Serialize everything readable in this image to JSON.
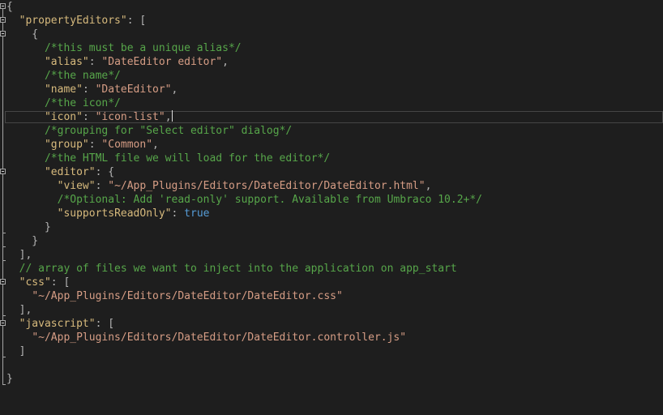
{
  "lines": [
    [
      {
        "t": "p",
        "v": "{"
      }
    ],
    [
      {
        "t": "p",
        "v": "  "
      },
      {
        "t": "k",
        "v": "\"propertyEditors\""
      },
      {
        "t": "p",
        "v": ": ["
      }
    ],
    [
      {
        "t": "p",
        "v": "    {"
      }
    ],
    [
      {
        "t": "p",
        "v": "      "
      },
      {
        "t": "c",
        "v": "/*this must be a unique alias*/"
      }
    ],
    [
      {
        "t": "p",
        "v": "      "
      },
      {
        "t": "k",
        "v": "\"alias\""
      },
      {
        "t": "p",
        "v": ": "
      },
      {
        "t": "s",
        "v": "\"DateEditor editor\""
      },
      {
        "t": "p",
        "v": ","
      }
    ],
    [
      {
        "t": "p",
        "v": "      "
      },
      {
        "t": "c",
        "v": "/*the name*/"
      }
    ],
    [
      {
        "t": "p",
        "v": "      "
      },
      {
        "t": "k",
        "v": "\"name\""
      },
      {
        "t": "p",
        "v": ": "
      },
      {
        "t": "s",
        "v": "\"DateEditor\""
      },
      {
        "t": "p",
        "v": ","
      }
    ],
    [
      {
        "t": "p",
        "v": "      "
      },
      {
        "t": "c",
        "v": "/*the icon*/"
      }
    ],
    [
      {
        "t": "p",
        "v": "      "
      },
      {
        "t": "k",
        "v": "\"icon\""
      },
      {
        "t": "p",
        "v": ": "
      },
      {
        "t": "s",
        "v": "\"icon-list\""
      },
      {
        "t": "p",
        "v": ","
      },
      {
        "t": "caret",
        "v": ""
      }
    ],
    [
      {
        "t": "p",
        "v": "      "
      },
      {
        "t": "c",
        "v": "/*grouping for \"Select editor\" dialog*/"
      }
    ],
    [
      {
        "t": "p",
        "v": "      "
      },
      {
        "t": "k",
        "v": "\"group\""
      },
      {
        "t": "p",
        "v": ": "
      },
      {
        "t": "s",
        "v": "\"Common\""
      },
      {
        "t": "p",
        "v": ","
      }
    ],
    [
      {
        "t": "p",
        "v": "      "
      },
      {
        "t": "c",
        "v": "/*the HTML file we will load for the editor*/"
      }
    ],
    [
      {
        "t": "p",
        "v": "      "
      },
      {
        "t": "k",
        "v": "\"editor\""
      },
      {
        "t": "p",
        "v": ": {"
      }
    ],
    [
      {
        "t": "p",
        "v": "        "
      },
      {
        "t": "k",
        "v": "\"view\""
      },
      {
        "t": "p",
        "v": ": "
      },
      {
        "t": "s",
        "v": "\"~/App_Plugins/Editors/DateEditor/DateEditor.html\""
      },
      {
        "t": "p",
        "v": ","
      }
    ],
    [
      {
        "t": "p",
        "v": "        "
      },
      {
        "t": "c",
        "v": "/*Optional: Add 'read-only' support. Available from Umbraco 10.2+*/"
      }
    ],
    [
      {
        "t": "p",
        "v": "        "
      },
      {
        "t": "k",
        "v": "\"supportsReadOnly\""
      },
      {
        "t": "p",
        "v": ": "
      },
      {
        "t": "b",
        "v": "true"
      }
    ],
    [
      {
        "t": "p",
        "v": "      }"
      }
    ],
    [
      {
        "t": "p",
        "v": "    }"
      }
    ],
    [
      {
        "t": "p",
        "v": "  ],"
      }
    ],
    [
      {
        "t": "p",
        "v": "  "
      },
      {
        "t": "c",
        "v": "// array of files we want to inject into the application on app_start"
      }
    ],
    [
      {
        "t": "p",
        "v": "  "
      },
      {
        "t": "k",
        "v": "\"css\""
      },
      {
        "t": "p",
        "v": ": ["
      }
    ],
    [
      {
        "t": "p",
        "v": "    "
      },
      {
        "t": "s",
        "v": "\"~/App_Plugins/Editors/DateEditor/DateEditor.css\""
      }
    ],
    [
      {
        "t": "p",
        "v": "  ],"
      }
    ],
    [
      {
        "t": "p",
        "v": "  "
      },
      {
        "t": "k",
        "v": "\"javascript\""
      },
      {
        "t": "p",
        "v": ": ["
      }
    ],
    [
      {
        "t": "p",
        "v": "    "
      },
      {
        "t": "s",
        "v": "\"~/App_Plugins/Editors/DateEditor/DateEditor.controller.js\""
      }
    ],
    [
      {
        "t": "p",
        "v": "  ]"
      }
    ],
    [
      {
        "t": "p",
        "v": ""
      }
    ],
    [
      {
        "t": "p",
        "v": "}"
      }
    ]
  ]
}
